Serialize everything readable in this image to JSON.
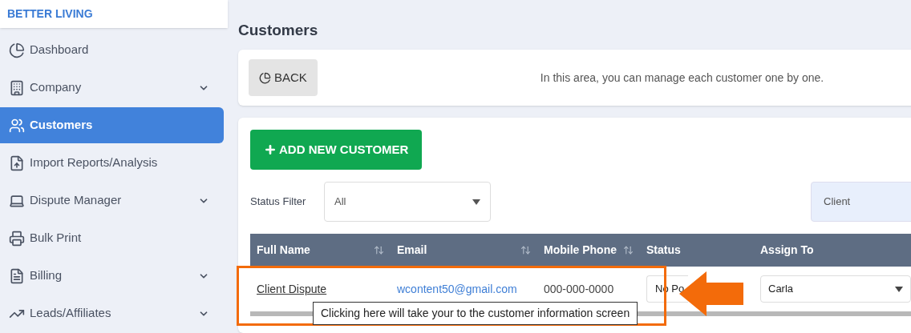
{
  "brand": "BETTER LIVING",
  "sidebar": {
    "items": [
      {
        "label": "Dashboard",
        "selected": false,
        "expandable": false
      },
      {
        "label": "Company",
        "selected": false,
        "expandable": true
      },
      {
        "label": "Customers",
        "selected": true,
        "expandable": false
      },
      {
        "label": "Import Reports/Analysis",
        "selected": false,
        "expandable": false
      },
      {
        "label": "Dispute Manager",
        "selected": false,
        "expandable": true
      },
      {
        "label": "Bulk Print",
        "selected": false,
        "expandable": false
      },
      {
        "label": "Billing",
        "selected": false,
        "expandable": true
      },
      {
        "label": "Leads/Affiliates",
        "selected": false,
        "expandable": true
      }
    ]
  },
  "page_title": "Customers",
  "back_button": "BACK",
  "info_text": "In this area, you can manage each customer one by one.",
  "add_button": "ADD NEW CUSTOMER",
  "status_filter": {
    "label": "Status Filter",
    "value": "All"
  },
  "type_field": {
    "value": "Client"
  },
  "table": {
    "columns": [
      {
        "label": "Full Name",
        "sortable": true
      },
      {
        "label": "Email",
        "sortable": true
      },
      {
        "label": "Mobile Phone",
        "sortable": true
      },
      {
        "label": "Status",
        "sortable": false
      },
      {
        "label": "Assign To",
        "sortable": false
      }
    ],
    "rows": [
      {
        "name": "Client Dispute",
        "email": "wcontent50@gmail.com",
        "phone": "000-000-0000",
        "status": "No Po",
        "assign": "Carla"
      }
    ]
  },
  "tooltip": "Clicking here will take your to the customer information screen"
}
